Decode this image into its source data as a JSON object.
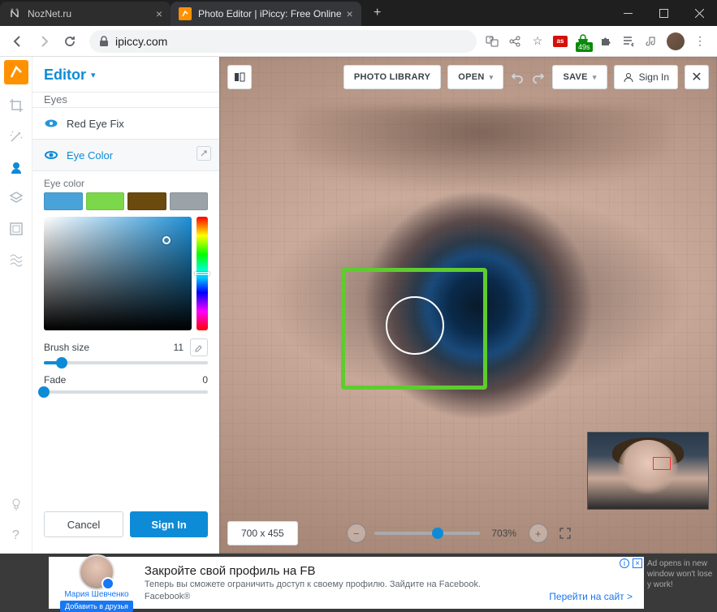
{
  "window": {
    "tabs": [
      {
        "title": "NozNet.ru",
        "active": false
      },
      {
        "title": "Photo Editor | iPiccy: Free Online",
        "active": true
      }
    ]
  },
  "addressbar": {
    "domain": "ipiccy.com",
    "ext_badge": "49s"
  },
  "panel": {
    "title": "Editor",
    "section_eyes": "Eyes",
    "red_eye": "Red Eye Fix",
    "eye_color_title": "Eye Color",
    "eye_color_label": "Eye color",
    "swatches": [
      "#4aa3d8",
      "#7bd84a",
      "#6b4a0e",
      "#9aa3a8"
    ],
    "brush_label": "Brush size",
    "brush_value": "11",
    "fade_label": "Fade",
    "fade_value": "0",
    "cancel": "Cancel",
    "signin": "Sign In"
  },
  "topbar": {
    "library": "PHOTO LIBRARY",
    "open": "OPEN",
    "save": "SAVE",
    "signin": "Sign In"
  },
  "bottombar": {
    "dims": "700 x 455",
    "zoom": "703%"
  },
  "ad": {
    "name": "Мария Шевченко",
    "add": "Добавить в друзья",
    "headline": "Закройте свой профиль на FB",
    "body": "Теперь вы сможете ограничить доступ к своему профилю. Зайдите на Facebook.",
    "brand": "Facebook®",
    "cta": "Перейти на сайт >",
    "info": "Ad opens in new window won't lose y work!"
  }
}
